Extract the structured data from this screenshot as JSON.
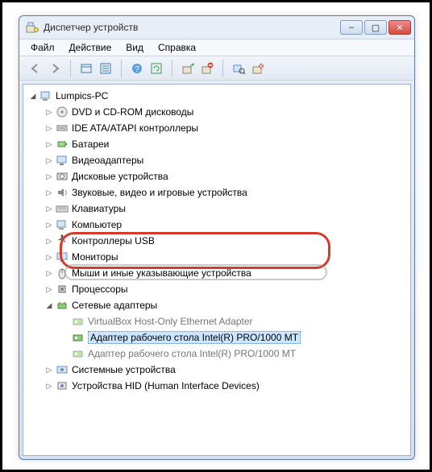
{
  "window": {
    "title": "Диспетчер устройств",
    "controls": {
      "min": "–",
      "max": "▢",
      "close": "✕"
    }
  },
  "menu": {
    "file": "Файл",
    "action": "Действие",
    "view": "Вид",
    "help": "Справка"
  },
  "toolbar": {
    "back": "back-icon",
    "forward": "forward-icon",
    "show_hidden": "show-hidden-icon",
    "details": "details-icon",
    "help": "help-icon",
    "refresh": "refresh-icon",
    "update_driver": "update-driver-icon",
    "uninstall": "uninstall-icon",
    "scan": "scan-hardware-icon",
    "properties": "properties-icon"
  },
  "tree": {
    "root": "Lumpics-PC",
    "items": [
      {
        "label": "DVD и CD-ROM дисководы",
        "icon": "disc-icon"
      },
      {
        "label": "IDE ATA/ATAPI контроллеры",
        "icon": "ide-icon"
      },
      {
        "label": "Батареи",
        "icon": "battery-icon"
      },
      {
        "label": "Видеоадаптеры",
        "icon": "display-adapter-icon"
      },
      {
        "label": "Дисковые устройства",
        "icon": "disk-icon"
      },
      {
        "label": "Звуковые, видео и игровые устройства",
        "icon": "sound-icon"
      },
      {
        "label": "Клавиатуры",
        "icon": "keyboard-icon"
      },
      {
        "label": "Компьютер",
        "icon": "computer-icon"
      },
      {
        "label": "Контроллеры USB",
        "icon": "usb-icon"
      },
      {
        "label": "Мониторы",
        "icon": "monitor-icon"
      },
      {
        "label": "Мыши и иные указывающие устройства",
        "icon": "mouse-icon"
      },
      {
        "label": "Процессоры",
        "icon": "cpu-icon"
      },
      {
        "label": "Сетевые адаптеры",
        "icon": "network-icon"
      },
      {
        "label": "Системные устройства",
        "icon": "system-icon"
      },
      {
        "label": "Устройства HID (Human Interface Devices)",
        "icon": "hid-icon"
      }
    ],
    "network_children": [
      {
        "label": "VirtualBox Host-Only Ethernet Adapter"
      },
      {
        "label": "Адаптер рабочего стола Intel(R) PRO/1000 MT"
      },
      {
        "label": "Адаптер рабочего стола Intel(R) PRO/1000 MT"
      }
    ]
  }
}
